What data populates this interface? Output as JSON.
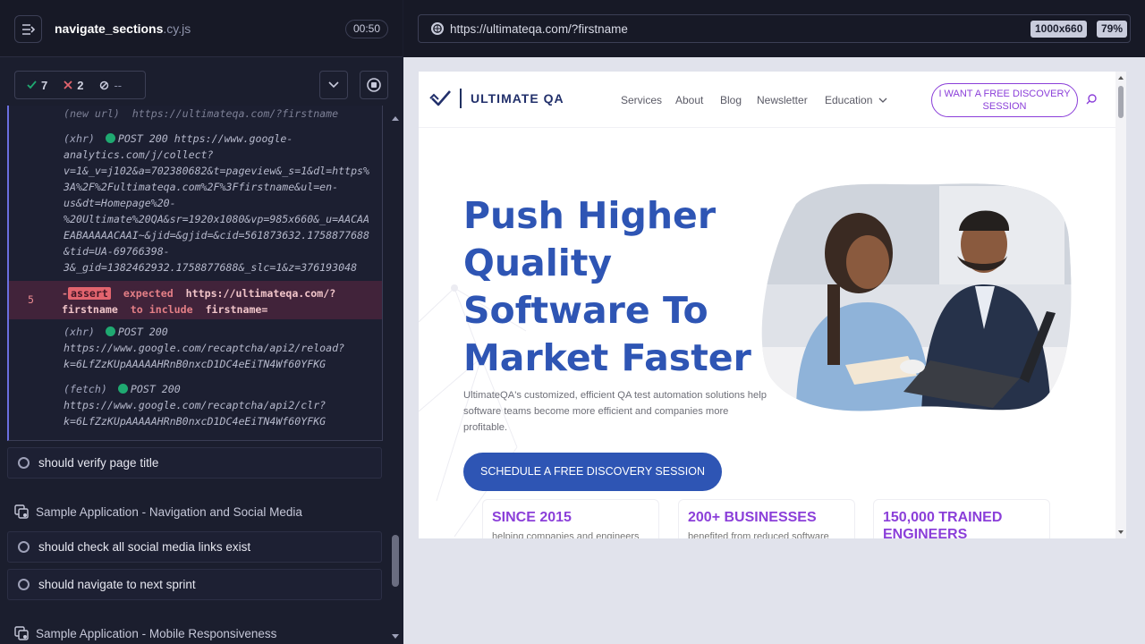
{
  "spec": {
    "name": "navigate_sections",
    "ext": ".cy.js",
    "timer": "00:50"
  },
  "stats": {
    "passed": "7",
    "failed": "2",
    "pending": "--"
  },
  "log": {
    "clipped_line": "(new url)  https://ultimateqa.com/?firstname",
    "xhr1_kw": "(xhr)",
    "xhr1_method": "POST 200 https://www.google-",
    "xhr1_lines": "analytics.com/j/collect?\nv=1&_v=j102&a=702380682&t=pageview&_s=1&dl=https%\n3A%2F%2Fultimateqa.com%2F%3Ffirstname&ul=en-\nus&dt=Homepage%20-\n%20Ultimate%20QA&sr=1920x1080&vp=985x660&_u=AACAA\nEABAAAAACAAI~&jid=&gjid=&cid=561873632.1758877688\n&tid=UA-69766398-\n3&_gid=1382462932.1758877688&_slc=1&z=376193048",
    "assert_num": "5",
    "assert_badge": "assert",
    "assert_expected": "expected",
    "assert_url": "https://ultimateqa.com/?",
    "assert_url2": "firstname",
    "assert_include": "to include",
    "assert_value": "firstname=",
    "xhr2_kw": "(xhr)",
    "xhr2_method": "POST 200",
    "xhr2_lines": "https://www.google.com/recaptcha/api2/reload?\nk=6LfZzKUpAAAAAHRnB0nxcD1DC4eEiTN4Wf60YFKG",
    "fetch_kw": "(fetch)",
    "fetch_method": "POST 200",
    "fetch_lines": "https://www.google.com/recaptcha/api2/clr?\nk=6LfZzKUpAAAAAHRnB0nxcD1DC4eEiTN4Wf60YFKG"
  },
  "tests": {
    "verify_title": "should verify page title",
    "suite_nav": "Sample Application - Navigation and Social Media",
    "social_links": "should check all social media links exist",
    "next_sprint": "should navigate to next sprint",
    "suite_mobile": "Sample Application - Mobile Responsiveness"
  },
  "aut": {
    "url": "https://ultimateqa.com/?firstname",
    "viewport": "1000x660",
    "zoom": "79%"
  },
  "site": {
    "logo": "ULTIMATE QA",
    "nav": [
      "Services",
      "About",
      "Blog",
      "Newsletter",
      "Education"
    ],
    "cta": "I WANT A FREE DISCOVERY SESSION",
    "hero_title": "Push Higher Quality Software To Market Faster",
    "hero_sub": "UltimateQA's customized, efficient QA test automation solutions help software teams become more efficient and companies more profitable.",
    "hero_button": "SCHEDULE A FREE DISCOVERY SESSION",
    "cards": [
      {
        "big": "SINCE 2015",
        "small": "helping companies and engineers"
      },
      {
        "big": "200+ BUSINESSES",
        "small": "benefited from reduced software"
      },
      {
        "big": "150,000 TRAINED ENGINEERS",
        "small": ""
      }
    ]
  },
  "colors": {
    "accent": "#2e55b4",
    "purple": "#8b3fd9",
    "fail": "#e2646e",
    "pass": "#1fa971"
  }
}
